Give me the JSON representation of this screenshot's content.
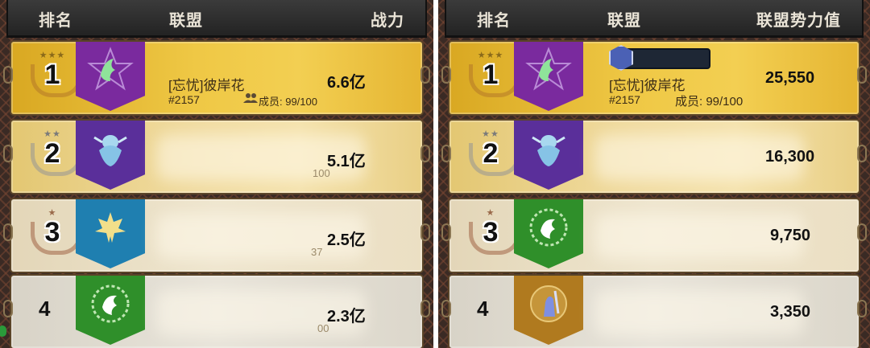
{
  "left_panel": {
    "headers": {
      "rank": "排名",
      "alliance": "联盟",
      "power": "战力"
    },
    "rows": [
      {
        "rank": "1",
        "name": "[忘忧]彼岸花",
        "tag": "#2157",
        "members": "成员: 99/100",
        "power": "6.6亿",
        "banner_color": "#7a2a9e",
        "emblem": "phoenix-star-icon"
      },
      {
        "rank": "2",
        "name": "",
        "tag": "",
        "members": "",
        "power": "5.1亿",
        "fragment": "100",
        "banner_color": "#5a2f9a",
        "emblem": "dragon-icon"
      },
      {
        "rank": "3",
        "name": "",
        "tag": "",
        "members": "",
        "power": "2.5亿",
        "fragment": "37",
        "banner_color": "#1f7fb0",
        "emblem": "maple-leaf-icon"
      },
      {
        "rank": "4",
        "name": "",
        "tag": "",
        "members": "",
        "power": "2.3亿",
        "fragment": "00",
        "banner_color": "#2f8f2a",
        "emblem": "phoenix-wreath-icon"
      }
    ]
  },
  "right_panel": {
    "headers": {
      "rank": "排名",
      "alliance": "联盟",
      "power": "联盟势力值"
    },
    "rows": [
      {
        "rank": "1",
        "name": "[忘忧]彼岸花",
        "tag": "#2157",
        "members": "成员: 99/100",
        "power": "25,550",
        "banner_color": "#7a2a9e",
        "emblem": "phoenix-star-icon"
      },
      {
        "rank": "2",
        "power": "16,300",
        "banner_color": "#5a2f9a",
        "emblem": "dragon-icon"
      },
      {
        "rank": "3",
        "power": "9,750",
        "banner_color": "#2f8f2a",
        "emblem": "phoenix-wreath-icon"
      },
      {
        "rank": "4",
        "power": "3,350",
        "banner_color": "#b07a1f",
        "emblem": "knight-icon"
      }
    ]
  }
}
